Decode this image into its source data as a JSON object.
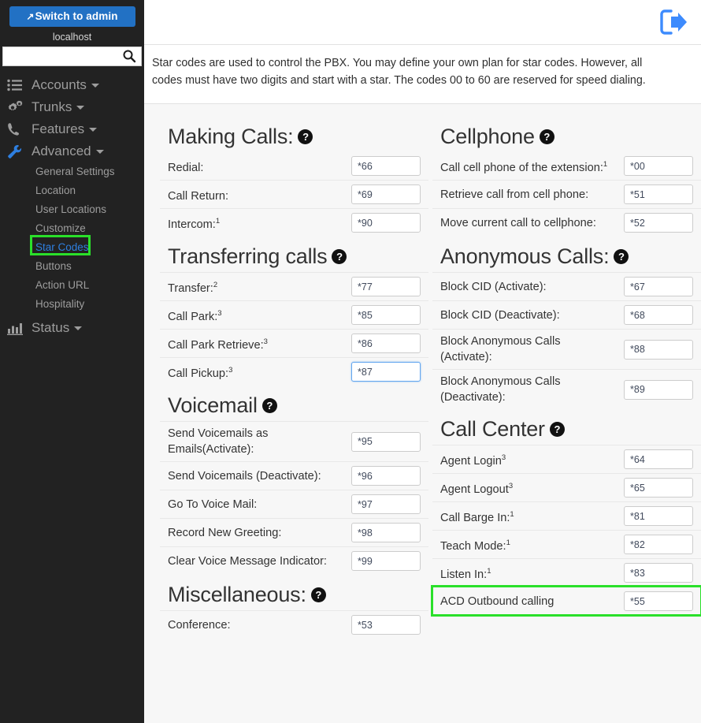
{
  "sidebar": {
    "switch_button": {
      "label": "Switch to admin",
      "icon": "external-link-icon"
    },
    "host": "localhost",
    "search": {
      "value": "",
      "placeholder": "",
      "icon": "search-icon"
    },
    "nav": [
      {
        "label": "Accounts",
        "icon": "list-icon",
        "caret": true
      },
      {
        "label": "Trunks",
        "icon": "cogs-icon",
        "caret": true
      },
      {
        "label": "Features",
        "icon": "phone-icon",
        "caret": true
      },
      {
        "label": "Advanced",
        "icon": "wrench-icon",
        "caret": true,
        "active": true
      }
    ],
    "advanced_items": [
      {
        "label": "General Settings"
      },
      {
        "label": "Location"
      },
      {
        "label": "User Locations"
      },
      {
        "label": "Customize"
      },
      {
        "label": "Star Codes",
        "active": true,
        "highlighted": true
      },
      {
        "label": "Buttons"
      },
      {
        "label": "Action URL"
      },
      {
        "label": "Hospitality"
      }
    ],
    "status": {
      "label": "Status",
      "icon": "bar-chart-icon",
      "caret": true
    }
  },
  "topbar": {
    "logout_icon": "logout-icon"
  },
  "intro": {
    "text": "Star codes are used to control the PBX. You may define your own plan for star codes. However, all codes must have two digits and start with a star. The codes 00 to 60 are reserved for speed dialing."
  },
  "help_icon_glyph": "?",
  "left_column": [
    {
      "title": "Making Calls:",
      "help": true,
      "rows": [
        {
          "label": "Redial:",
          "sup": "",
          "value": "*66"
        },
        {
          "label": "Call Return:",
          "sup": "",
          "value": "*69"
        },
        {
          "label": "Intercom:",
          "sup": "1",
          "value": "*90"
        }
      ]
    },
    {
      "title": "Transferring calls",
      "help": true,
      "rows": [
        {
          "label": "Transfer:",
          "sup": "2",
          "value": "*77"
        },
        {
          "label": "Call Park:",
          "sup": "3",
          "value": "*85"
        },
        {
          "label": "Call Park Retrieve:",
          "sup": "3",
          "value": "*86"
        },
        {
          "label": "Call Pickup:",
          "sup": "3",
          "value": "*87",
          "focused": true
        }
      ]
    },
    {
      "title": "Voicemail",
      "help": true,
      "rows": [
        {
          "label": "Send Voicemails as Emails(Activate):",
          "sup": "",
          "value": "*95"
        },
        {
          "label": "Send Voicemails (Deactivate):",
          "sup": "",
          "value": "*96"
        },
        {
          "label": "Go To Voice Mail:",
          "sup": "",
          "value": "*97"
        },
        {
          "label": "Record New Greeting:",
          "sup": "",
          "value": "*98"
        },
        {
          "label": "Clear Voice Message Indicator:",
          "sup": "",
          "value": "*99"
        }
      ]
    },
    {
      "title": "Miscellaneous:",
      "help": true,
      "rows": [
        {
          "label": "Conference:",
          "sup": "",
          "value": "*53"
        }
      ]
    }
  ],
  "right_column": [
    {
      "title": "Cellphone",
      "help": true,
      "rows": [
        {
          "label": "Call cell phone of the extension:",
          "sup": "1",
          "value": "*00"
        },
        {
          "label": "Retrieve call from cell phone:",
          "sup": "",
          "value": "*51"
        },
        {
          "label": "Move current call to cellphone:",
          "sup": "",
          "value": "*52"
        }
      ]
    },
    {
      "title": "Anonymous Calls:",
      "help": true,
      "rows": [
        {
          "label": "Block CID (Activate):",
          "sup": "",
          "value": "*67"
        },
        {
          "label": "Block CID (Deactivate):",
          "sup": "",
          "value": "*68"
        },
        {
          "label": "Block Anonymous Calls (Activate):",
          "sup": "",
          "value": "*88"
        },
        {
          "label": "Block Anonymous Calls (Deactivate):",
          "sup": "",
          "value": "*89"
        }
      ]
    },
    {
      "title": "Call Center",
      "help": true,
      "rows": [
        {
          "label": "Agent Login",
          "sup": "3",
          "value": "*64"
        },
        {
          "label": "Agent Logout",
          "sup": "3",
          "value": "*65"
        },
        {
          "label": "Call Barge In:",
          "sup": "1",
          "value": "*81"
        },
        {
          "label": "Teach Mode:",
          "sup": "1",
          "value": "*82"
        },
        {
          "label": "Listen In:",
          "sup": "1",
          "value": "*83"
        },
        {
          "label": "ACD Outbound calling",
          "sup": "",
          "value": "*55",
          "highlighted": true
        }
      ]
    }
  ],
  "colors": {
    "sidebar_bg": "#222222",
    "accent_blue": "#2271c4",
    "link_blue": "#2e7fe0",
    "highlight_green": "#2ae02a",
    "page_bg": "#f7f7f7"
  }
}
